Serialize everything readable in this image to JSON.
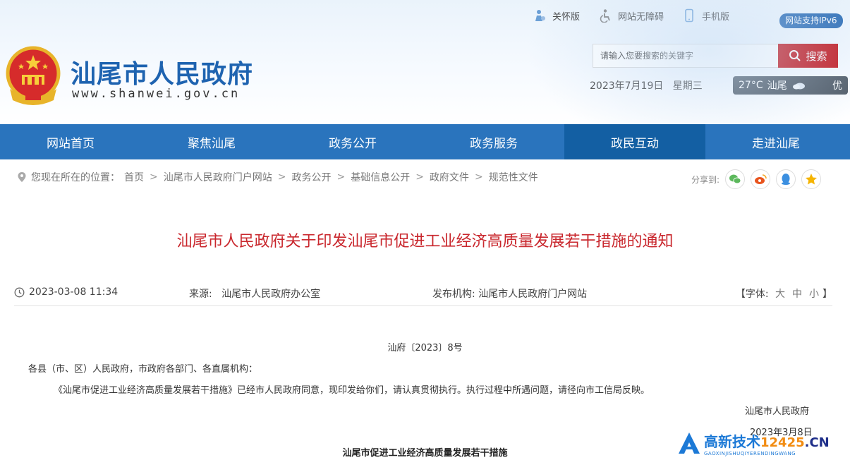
{
  "header": {
    "site_title": "汕尾市人民政府",
    "site_url": "www.shanwei.gov.cn",
    "top_links": [
      {
        "label": "关怀版",
        "icon": "elderly-care-icon"
      },
      {
        "label": "网站无障碍",
        "icon": "accessibility-icon"
      },
      {
        "label": "手机版",
        "icon": "mobile-phone-icon"
      }
    ],
    "ipv6_badge": "网站支持IPv6",
    "search": {
      "placeholder": "请输入您要搜索的关键字",
      "button_label": "搜索"
    },
    "date": "2023年7月19日",
    "weekday": "星期三",
    "weather": {
      "temperature": "27°C",
      "city": "汕尾",
      "icon": "cloudy-weather-icon",
      "air_quality": "优"
    }
  },
  "nav": {
    "items": [
      {
        "label": "网站首页",
        "active": false
      },
      {
        "label": "聚焦汕尾",
        "active": false
      },
      {
        "label": "政务公开",
        "active": false
      },
      {
        "label": "政务服务",
        "active": false
      },
      {
        "label": "政民互动",
        "active": true
      },
      {
        "label": "走进汕尾",
        "active": false
      }
    ]
  },
  "breadcrumb": {
    "prefix": "您现在所在的位置：",
    "items": [
      "首页",
      "汕尾市人民政府门户网站",
      "政务公开",
      "基础信息公开",
      "政府文件",
      "规范性文件"
    ],
    "separator": ">"
  },
  "share": {
    "label": "分享到:",
    "targets": [
      {
        "icon": "wechat-icon",
        "color": "#5cb85c"
      },
      {
        "icon": "weibo-icon",
        "color": "#e8541e"
      },
      {
        "icon": "qq-icon",
        "color": "#3b8fe0"
      },
      {
        "icon": "qzone-icon",
        "color": "#f5b400"
      }
    ]
  },
  "article": {
    "title": "汕尾市人民政府关于印发汕尾市促进工业经济高质量发展若干措施的通知",
    "time": "2023-03-08 11:34",
    "source_label": "来源:",
    "source": "汕尾市人民政府办公室",
    "publisher_label": "发布机构:",
    "publisher": "汕尾市人民政府门户网站",
    "font_label_open": "【字体:",
    "font_sizes": [
      "大",
      "中",
      "小"
    ],
    "font_label_close": "】",
    "doc_number": "汕府〔2023〕8号",
    "addressee": "各县（市、区）人民政府，市政府各部门、各直属机构：",
    "body": "《汕尾市促进工业经济高质量发展若干措施》已经市人民政府同意，现印发给你们，请认真贯彻执行。执行过程中所遇问题，请径向市工信局反映。",
    "signature_org": "汕尾市人民政府",
    "signature_date": "2023年3月8日",
    "subtitle": "汕尾市促进工业经济高质量发展若干措施"
  },
  "watermark": {
    "main": "高新技术",
    "num": "12425",
    "cn": ".CN",
    "sub": "GAOXINJISHUQIYERENDINGWANG"
  },
  "colors": {
    "nav_bg": "#2a74bd",
    "nav_active": "#135fa3",
    "title_red": "#c9272d",
    "search_red": "#c3161c",
    "brand_blue": "#1e63b0"
  }
}
